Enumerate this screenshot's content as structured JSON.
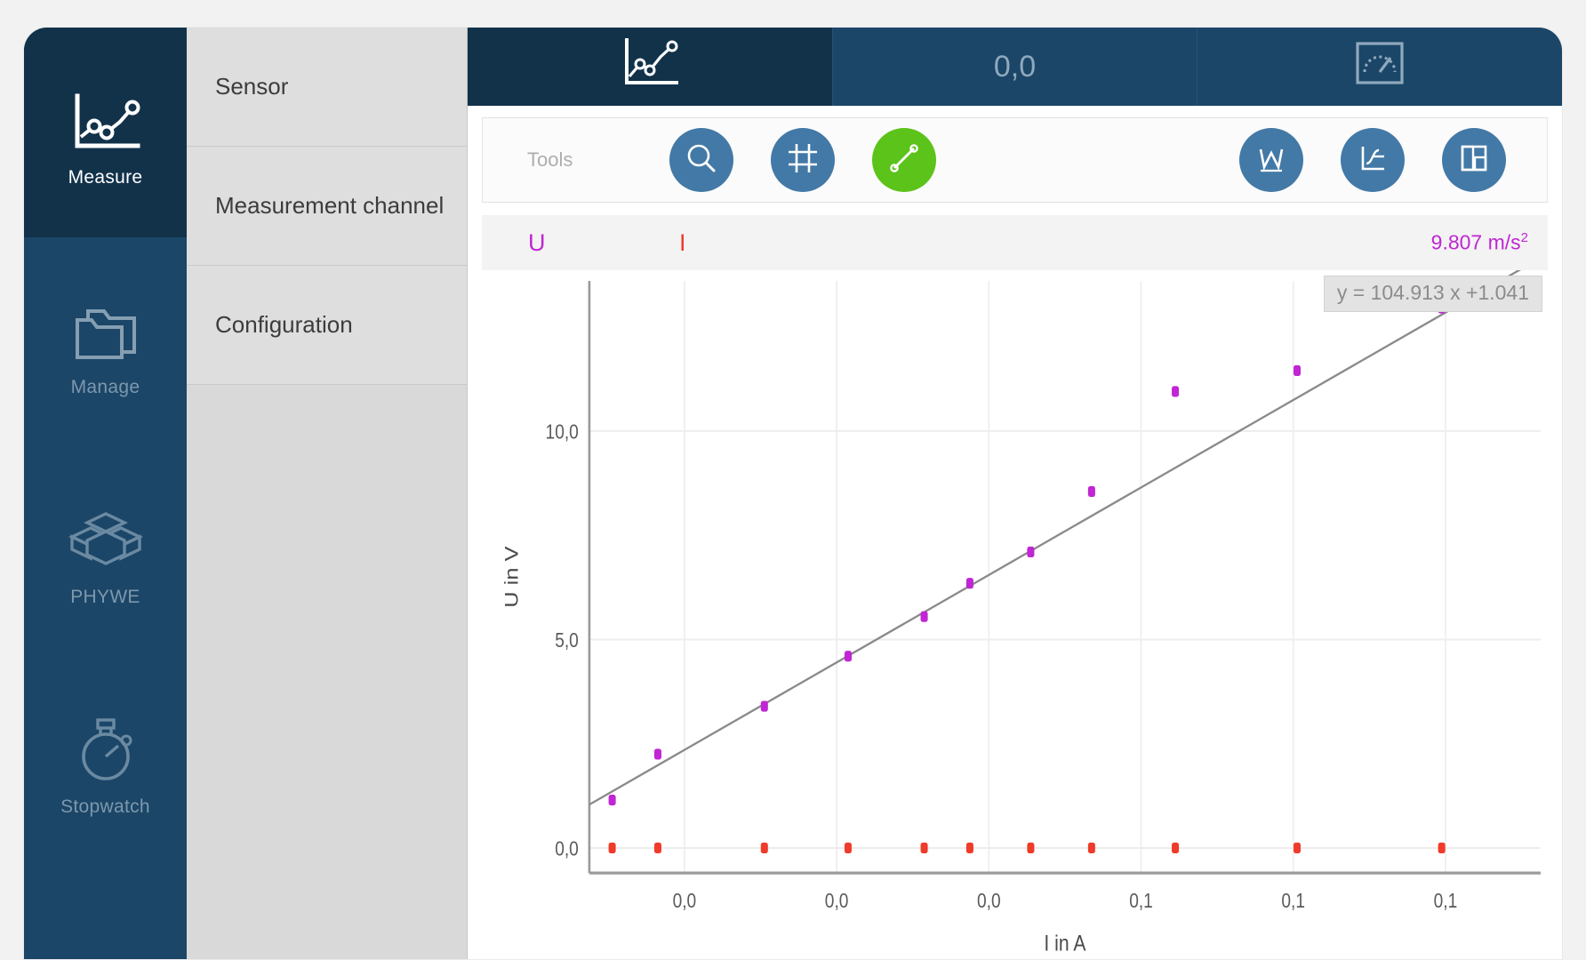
{
  "sidebar": {
    "items": [
      {
        "label": "Measure",
        "icon": "line-chart-icon",
        "active": true
      },
      {
        "label": "Manage",
        "icon": "folders-icon",
        "active": false
      },
      {
        "label": "PHYWE",
        "icon": "cubes-logo-icon",
        "active": false
      },
      {
        "label": "Stopwatch",
        "icon": "stopwatch-icon",
        "active": false
      }
    ]
  },
  "panel": {
    "items": [
      {
        "label": "Sensor"
      },
      {
        "label": "Measurement channel"
      },
      {
        "label": "Configuration"
      }
    ]
  },
  "tabs": [
    {
      "label": "",
      "icon": "line-chart-icon",
      "active": true
    },
    {
      "label": "0,0",
      "icon": "",
      "active": false
    },
    {
      "label": "",
      "icon": "gauge-icon",
      "active": false
    }
  ],
  "toolbar": {
    "label": "Tools",
    "buttons": [
      {
        "name": "zoom-tool",
        "icon": "magnifier-icon",
        "active": false
      },
      {
        "name": "crosshair-tool",
        "icon": "crosshair-icon",
        "active": false
      },
      {
        "name": "slope-tool",
        "icon": "slope-line-icon",
        "active": true
      },
      {
        "name": "peak-analysis-tool",
        "icon": "peak-w-icon",
        "active": false
      },
      {
        "name": "derivative-tool",
        "icon": "derivative-icon",
        "active": false
      },
      {
        "name": "layout-tool",
        "icon": "panels-icon",
        "active": false
      }
    ]
  },
  "legend": {
    "channel_u": "U",
    "channel_i": "I",
    "value": "9.807 m/s",
    "value_exponent": "2"
  },
  "colors": {
    "u_series": "#c026d3",
    "i_series": "#ef3b2c",
    "accent_navy": "#1b4668",
    "accent_navy_dark": "#12324a",
    "tool_blue": "#4379a6",
    "tool_green": "#5bc319",
    "fit_line": "#8a8a8a"
  },
  "chart_data": {
    "type": "scatter",
    "title": "",
    "xlabel": "I in A",
    "ylabel": "U in V",
    "fit_label": "y = 104.913 x +1.041",
    "fit_slope": 104.913,
    "fit_intercept": 1.041,
    "xlim": [
      0.0,
      0.125
    ],
    "ylim": [
      -0.6,
      13.6
    ],
    "xticks": [
      0.0125,
      0.0325,
      0.0525,
      0.0725,
      0.0925,
      0.1125
    ],
    "xticklabels": [
      "0,0",
      "0,0",
      "0,0",
      "0,1",
      "0,1",
      "0,1"
    ],
    "yticks": [
      0.0,
      5.0,
      10.0
    ],
    "yticklabels": [
      "0,0",
      "5,0",
      "10,0"
    ],
    "grid": true,
    "legend_position": "above-plot",
    "series": [
      {
        "name": "U",
        "color": "#c026d3",
        "unit": "V",
        "x": [
          0.003,
          0.009,
          0.023,
          0.034,
          0.044,
          0.05,
          0.058,
          0.066,
          0.077,
          0.093,
          0.112
        ],
        "y": [
          1.15,
          2.25,
          3.4,
          4.6,
          5.55,
          6.35,
          7.1,
          8.55,
          10.95,
          11.45,
          12.95
        ]
      },
      {
        "name": "I",
        "color": "#ef3b2c",
        "unit": "A",
        "x": [
          0.003,
          0.009,
          0.023,
          0.034,
          0.044,
          0.05,
          0.058,
          0.066,
          0.077,
          0.093,
          0.112
        ],
        "y": [
          0.0,
          0.0,
          0.0,
          0.0,
          0.0,
          0.0,
          0.0,
          0.0,
          0.0,
          0.0,
          0.0
        ]
      }
    ]
  }
}
